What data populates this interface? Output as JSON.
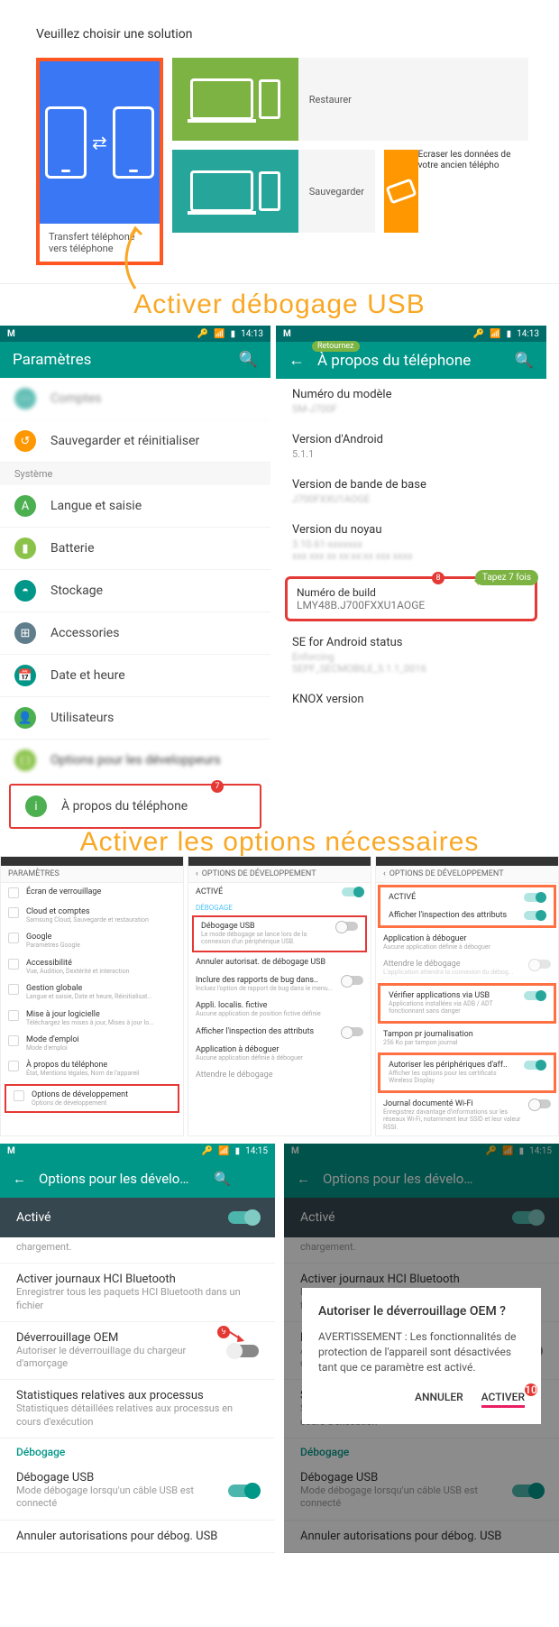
{
  "top": {
    "title": "Veuillez choisir une solution",
    "transfer_label": "Transfert téléphone vers téléphone",
    "restore_label": "Restaurer",
    "save_label": "Sauvegarder",
    "erase_label": "Ecraser les données de votre ancien télépho"
  },
  "headline1": "Activer débogage USB",
  "headline2": "Activer les options nécessaires",
  "status_time": "14:13",
  "status_time2": "14:15",
  "settings": {
    "title": "Paramètres",
    "backup": "Sauvegarder et réinitialiser",
    "system_cat": "Système",
    "lang": "Langue et saisie",
    "battery": "Batterie",
    "storage": "Stockage",
    "accessories": "Accessories",
    "date": "Date et heure",
    "users": "Utilisateurs",
    "blurred": "Options pour les développeurs",
    "about": "À propos du téléphone"
  },
  "about": {
    "title": "À propos du téléphone",
    "retournez": "Retournez",
    "model_lbl": "Numéro du modèle",
    "model_val": "SM-J700F",
    "android_lbl": "Version d'Android",
    "android_val": "5.1.1",
    "baseband_lbl": "Version de bande de base",
    "baseband_val": "J700FXXU1AOGE",
    "kernel_lbl": "Version du noyau",
    "build_lbl": "Numéro de build",
    "build_val": "LMY48B.J700FXXU1AOGE",
    "tap_tip": "Tapez 7 fois",
    "se_lbl": "SE for Android status",
    "knox_lbl": "KNOX version"
  },
  "mini1": {
    "header": "PARAMÈTRES",
    "lock": {
      "t": "Écran de verrouillage"
    },
    "cloud": {
      "t": "Cloud et comptes",
      "s": "Samsung Cloud, Sauvegarde et restauration"
    },
    "google": {
      "t": "Google",
      "s": "Paramètres Google"
    },
    "access": {
      "t": "Accessibilité",
      "s": "Vue, Audition, Dextérité et interaction"
    },
    "gestion": {
      "t": "Gestion globale",
      "s": "Langue et saisie, Date et heure, Réinitialisat..."
    },
    "maj": {
      "t": "Mise à jour logicielle",
      "s": "Téléchargez les mises à jour, Mises à jour lo..."
    },
    "mode": {
      "t": "Mode d'emploi",
      "s": "Mode d'emploi"
    },
    "about": {
      "t": "À propos du téléphone",
      "s": "État, Mentions légales, Nom de l'appareil"
    },
    "devopt": {
      "t": "Options de développement",
      "s": "Options de développement"
    }
  },
  "mini2": {
    "header": "OPTIONS DE DÉVELOPPEMENT",
    "active": "ACTIVÉ",
    "debug_cat": "DÉBOGAGE",
    "usb": {
      "t": "Débogage USB",
      "s": "Le mode débogage se lance lors de la connexion d'un périphérique USB."
    },
    "revoke": {
      "t": "Annuler autorisat. de débogage USB"
    },
    "bug": {
      "t": "Inclure des rapports de bug dans..",
      "s": "Incluez l'option de rapport de bug dans le menu..."
    },
    "mock": {
      "t": "Appli. localis. fictive",
      "s": "Aucune application de position fictive définie"
    },
    "inspect": {
      "t": "Afficher l'inspection des attributs"
    },
    "appdebug": {
      "t": "Application à déboguer",
      "s": "Aucune application définie à déboguer"
    },
    "wait": {
      "t": "Attendre le débogage"
    }
  },
  "mini3": {
    "header": "OPTIONS DE DÉVELOPPEMENT",
    "active": "ACTIVÉ",
    "inspect": {
      "t": "Afficher l'inspection des attributs"
    },
    "appdebug": {
      "t": "Application à déboguer",
      "s": "Aucune application définie à déboguer"
    },
    "wait": {
      "t": "Attendre le débogage",
      "s": "L'application attendra la connexion du débog..."
    },
    "verify": {
      "t": "Vérifier applications via USB",
      "s": "Applications installées via ADB / ADT fonctionnant sans danger"
    },
    "tampon": {
      "t": "Tampon pr journalisation",
      "s": "256 Ko par tampon journal"
    },
    "periph": {
      "t": "Autoriser les périphériques d'aff..",
      "s": "Afficher les options pour les certificats Wireless Display"
    },
    "wifi": {
      "t": "Journal documenté Wi-Fi",
      "s": "Enregistrez davantage d'informations sur les réseaux Wi-Fi, notamment leur SSID et leur valeur RSSI."
    }
  },
  "dev": {
    "title": "Options pour les dévelo…",
    "active": "Activé",
    "charge_sub": "chargement.",
    "hci": {
      "t": "Activer journaux HCI Bluetooth",
      "s": "Enregistrer tous les paquets HCI Bluetooth dans un fichier"
    },
    "oem": {
      "t": "Déverrouillage OEM",
      "s": "Autoriser le déverrouillage du chargeur d'amorçage"
    },
    "stats": {
      "t": "Statistiques relatives aux processus",
      "s": "Statistiques détaillées relatives aux processus en cours d'exécution"
    },
    "debug_cat": "Débogage",
    "usb": {
      "t": "Débogage USB",
      "s": "Mode débogage lorsqu'un câble USB est connecté"
    },
    "revoke": {
      "t": "Annuler autorisations pour débog. USB"
    }
  },
  "dialog": {
    "title": "Autoriser le déverrouillage OEM ?",
    "body": "AVERTISSEMENT : Les fonctionnalités de protection de l'appareil sont désactivées tant que ce paramètre est activé.",
    "cancel": "ANNULER",
    "ok": "ACTIVER"
  }
}
